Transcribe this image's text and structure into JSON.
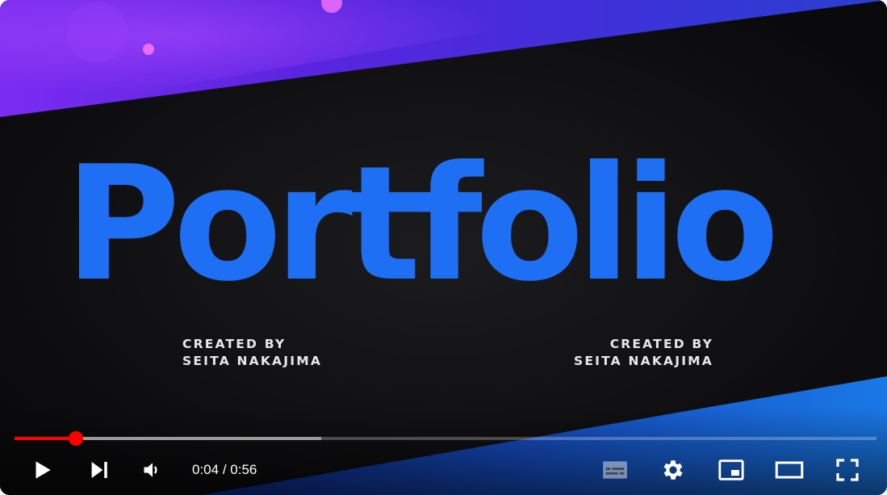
{
  "video": {
    "title_text": "Portfolio",
    "credit_left": {
      "line1": "CREATED BY",
      "line2": "SEITA NAKAJIMA"
    },
    "credit_right": {
      "line1": "CREATED BY",
      "line2": "SEITA NAKAJIMA"
    }
  },
  "player": {
    "current_time": "0:04",
    "time_separator": " / ",
    "duration": "0:56",
    "progress_fraction": 0.0714,
    "buffered_fraction": 0.356
  },
  "colors": {
    "accent": "#ff0000",
    "title_blue": "#1f6ff5",
    "band_purple": "#5a24e0",
    "band_blue": "#1a62d8"
  },
  "icons": {
    "play": "play-icon",
    "next": "next-icon",
    "volume": "volume-icon",
    "subtitles": "subtitles-icon",
    "settings": "settings-gear-icon",
    "miniplayer": "miniplayer-icon",
    "theater": "theater-mode-icon",
    "fullscreen": "fullscreen-icon"
  }
}
